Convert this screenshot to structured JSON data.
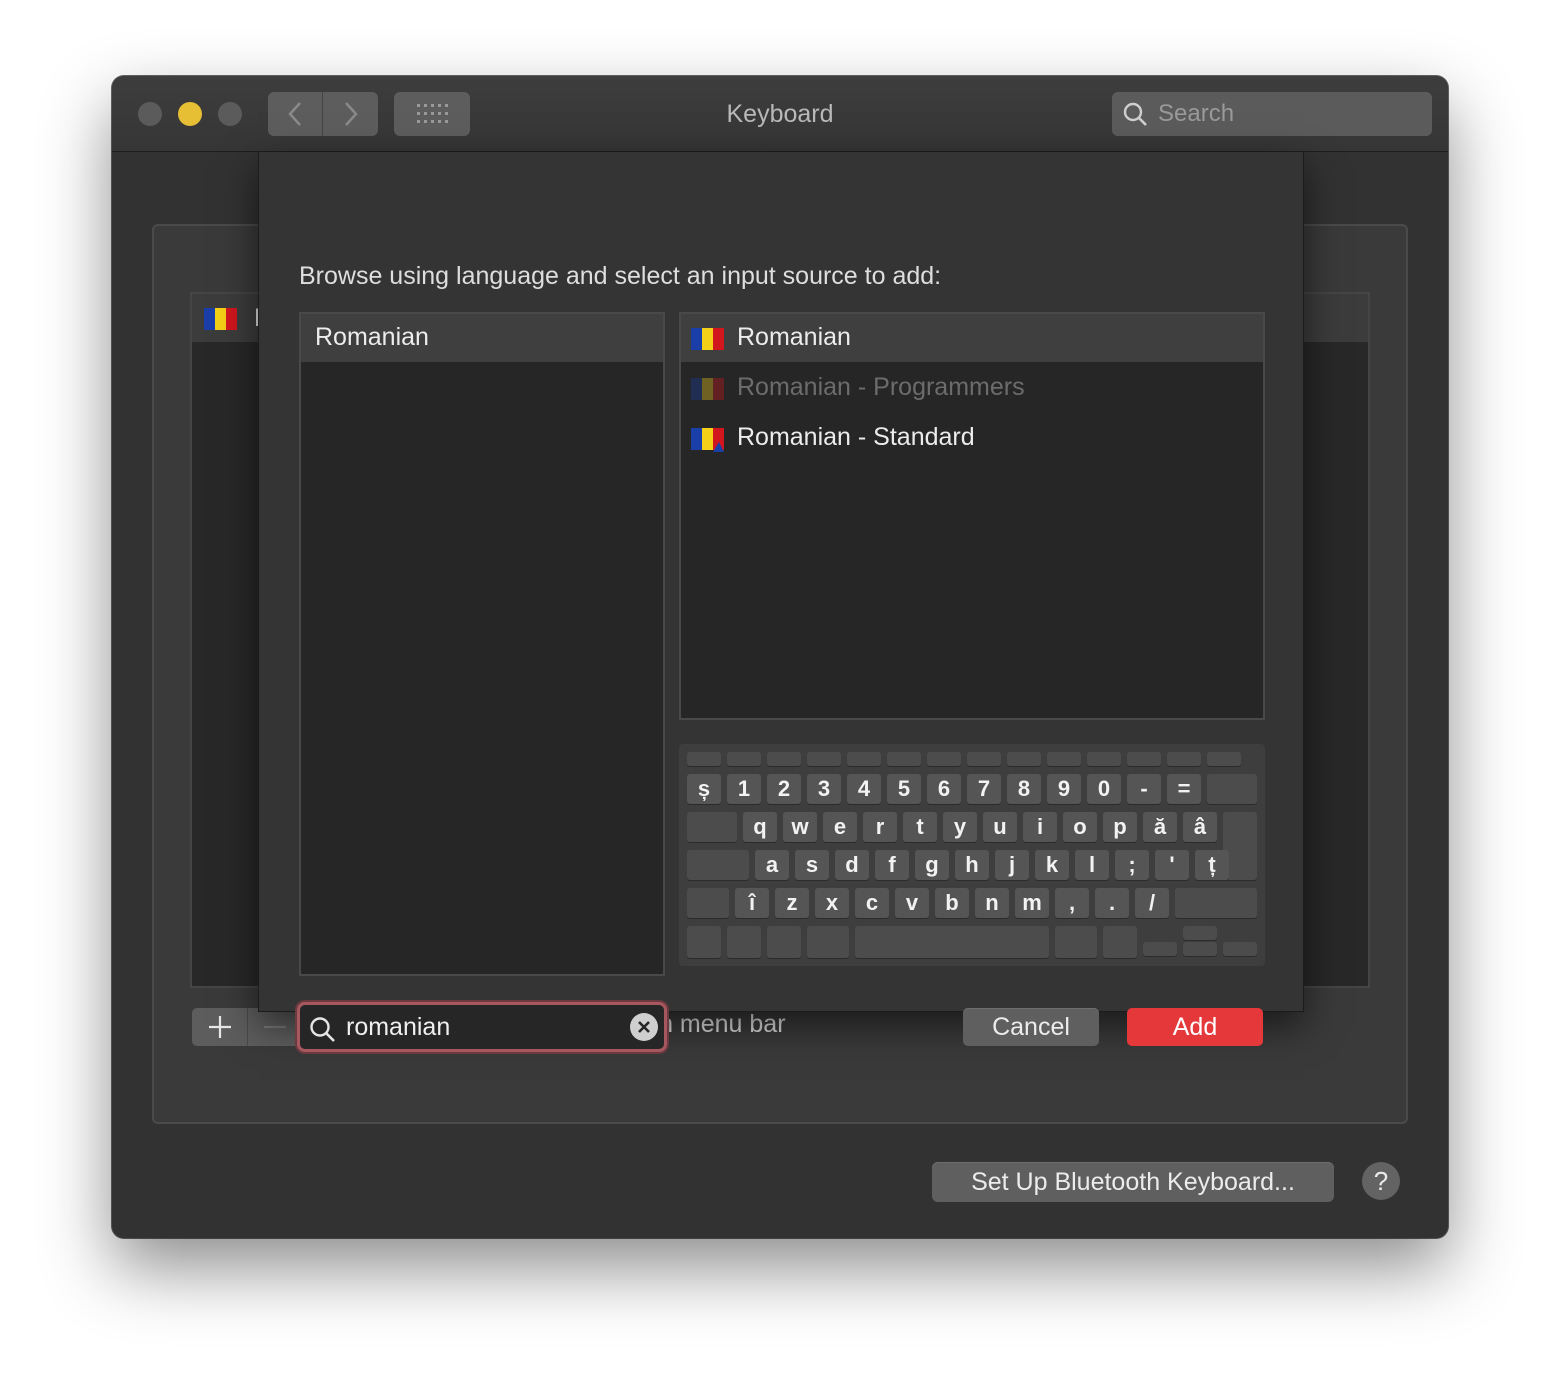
{
  "window": {
    "title": "Keyboard",
    "search_placeholder": "Search"
  },
  "background": {
    "list_item_label": "R",
    "show_input_menu_label": "Show Input menu in menu bar",
    "bluetooth_button": "Set Up Bluetooth Keyboard...",
    "help_label": "?"
  },
  "sheet": {
    "prompt": "Browse using language and select an input source to add:",
    "languages": [
      "Romanian"
    ],
    "sources": [
      {
        "label": "Romanian",
        "selected": true,
        "enabled": true
      },
      {
        "label": "Romanian - Programmers",
        "selected": false,
        "enabled": false
      },
      {
        "label": "Romanian - Standard",
        "selected": false,
        "enabled": true
      }
    ],
    "keyboard": {
      "row1": [
        "ș",
        "1",
        "2",
        "3",
        "4",
        "5",
        "6",
        "7",
        "8",
        "9",
        "0",
        "-",
        "="
      ],
      "row2": [
        "q",
        "w",
        "e",
        "r",
        "t",
        "y",
        "u",
        "i",
        "o",
        "p",
        "ă",
        "â"
      ],
      "row3": [
        "a",
        "s",
        "d",
        "f",
        "g",
        "h",
        "j",
        "k",
        "l",
        ";",
        "'",
        "ț"
      ],
      "row4": [
        "î",
        "z",
        "x",
        "c",
        "v",
        "b",
        "n",
        "m",
        ",",
        ".",
        "/"
      ]
    },
    "search_value": "romanian",
    "cancel_label": "Cancel",
    "add_label": "Add"
  },
  "colors": {
    "accent": "#e5383b",
    "focus_ring": "#a7585f",
    "window_bg": "#323232"
  },
  "icons": {
    "flag": "romanian-flag-icon",
    "search": "search-icon",
    "clear": "clear-icon"
  }
}
